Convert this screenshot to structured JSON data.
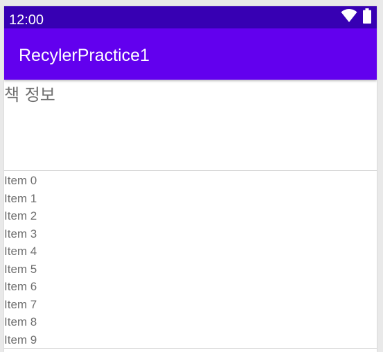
{
  "status_bar": {
    "time": "12:00",
    "icons": [
      "wifi-icon",
      "battery-icon"
    ],
    "color": "#3700b3"
  },
  "app_bar": {
    "title": "RecylerPractice1",
    "color": "#6200ee"
  },
  "header": {
    "title": "책 정보"
  },
  "list": {
    "items": [
      {
        "label": "Item 0"
      },
      {
        "label": "Item 1"
      },
      {
        "label": "Item 2"
      },
      {
        "label": "Item 3"
      },
      {
        "label": "Item 4"
      },
      {
        "label": "Item 5"
      },
      {
        "label": "Item 6"
      },
      {
        "label": "Item 7"
      },
      {
        "label": "Item 8"
      },
      {
        "label": "Item 9"
      }
    ]
  }
}
